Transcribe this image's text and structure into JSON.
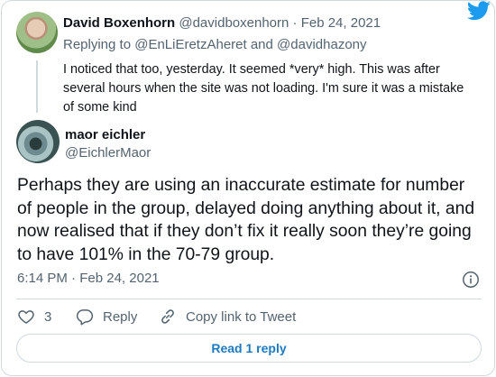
{
  "parent_tweet": {
    "author_name": "David Boxenhorn",
    "author_handle": "@davidboxenhorn",
    "date": "Feb 24, 2021",
    "separator": "·",
    "replying_prefix": "Replying to",
    "replying_to_1": "@EnLiEretzAheret",
    "replying_and": "and",
    "replying_to_2": "@davidhazony",
    "text": "I noticed that too, yesterday. It seemed *very* high. This was after several hours when the site was not loading. I'm sure it was a mistake of some kind"
  },
  "main_tweet": {
    "author_name": "maor eichler",
    "author_handle": "@EichlerMaor",
    "text": "Perhaps they are using an inaccurate estimate for number of people in the group, delayed doing anything about it, and now realised that if they don’t fix it really soon they’re going to have 101% in the 70-79 group.",
    "time": "6:14 PM",
    "separator": "·",
    "date": "Feb 24, 2021"
  },
  "actions": {
    "like_count": "3",
    "reply_label": "Reply",
    "copy_link_label": "Copy link to Tweet"
  },
  "read_replies_label": "Read 1 reply",
  "icons": {
    "brand": "twitter-bird-icon",
    "info": "info-icon",
    "like": "heart-icon",
    "reply": "speech-bubble-icon",
    "copy": "link-icon"
  },
  "colors": {
    "twitter_blue": "#1d9bf0",
    "link_blue": "#1d79c1",
    "muted": "#536471",
    "border": "#cfd9de"
  }
}
